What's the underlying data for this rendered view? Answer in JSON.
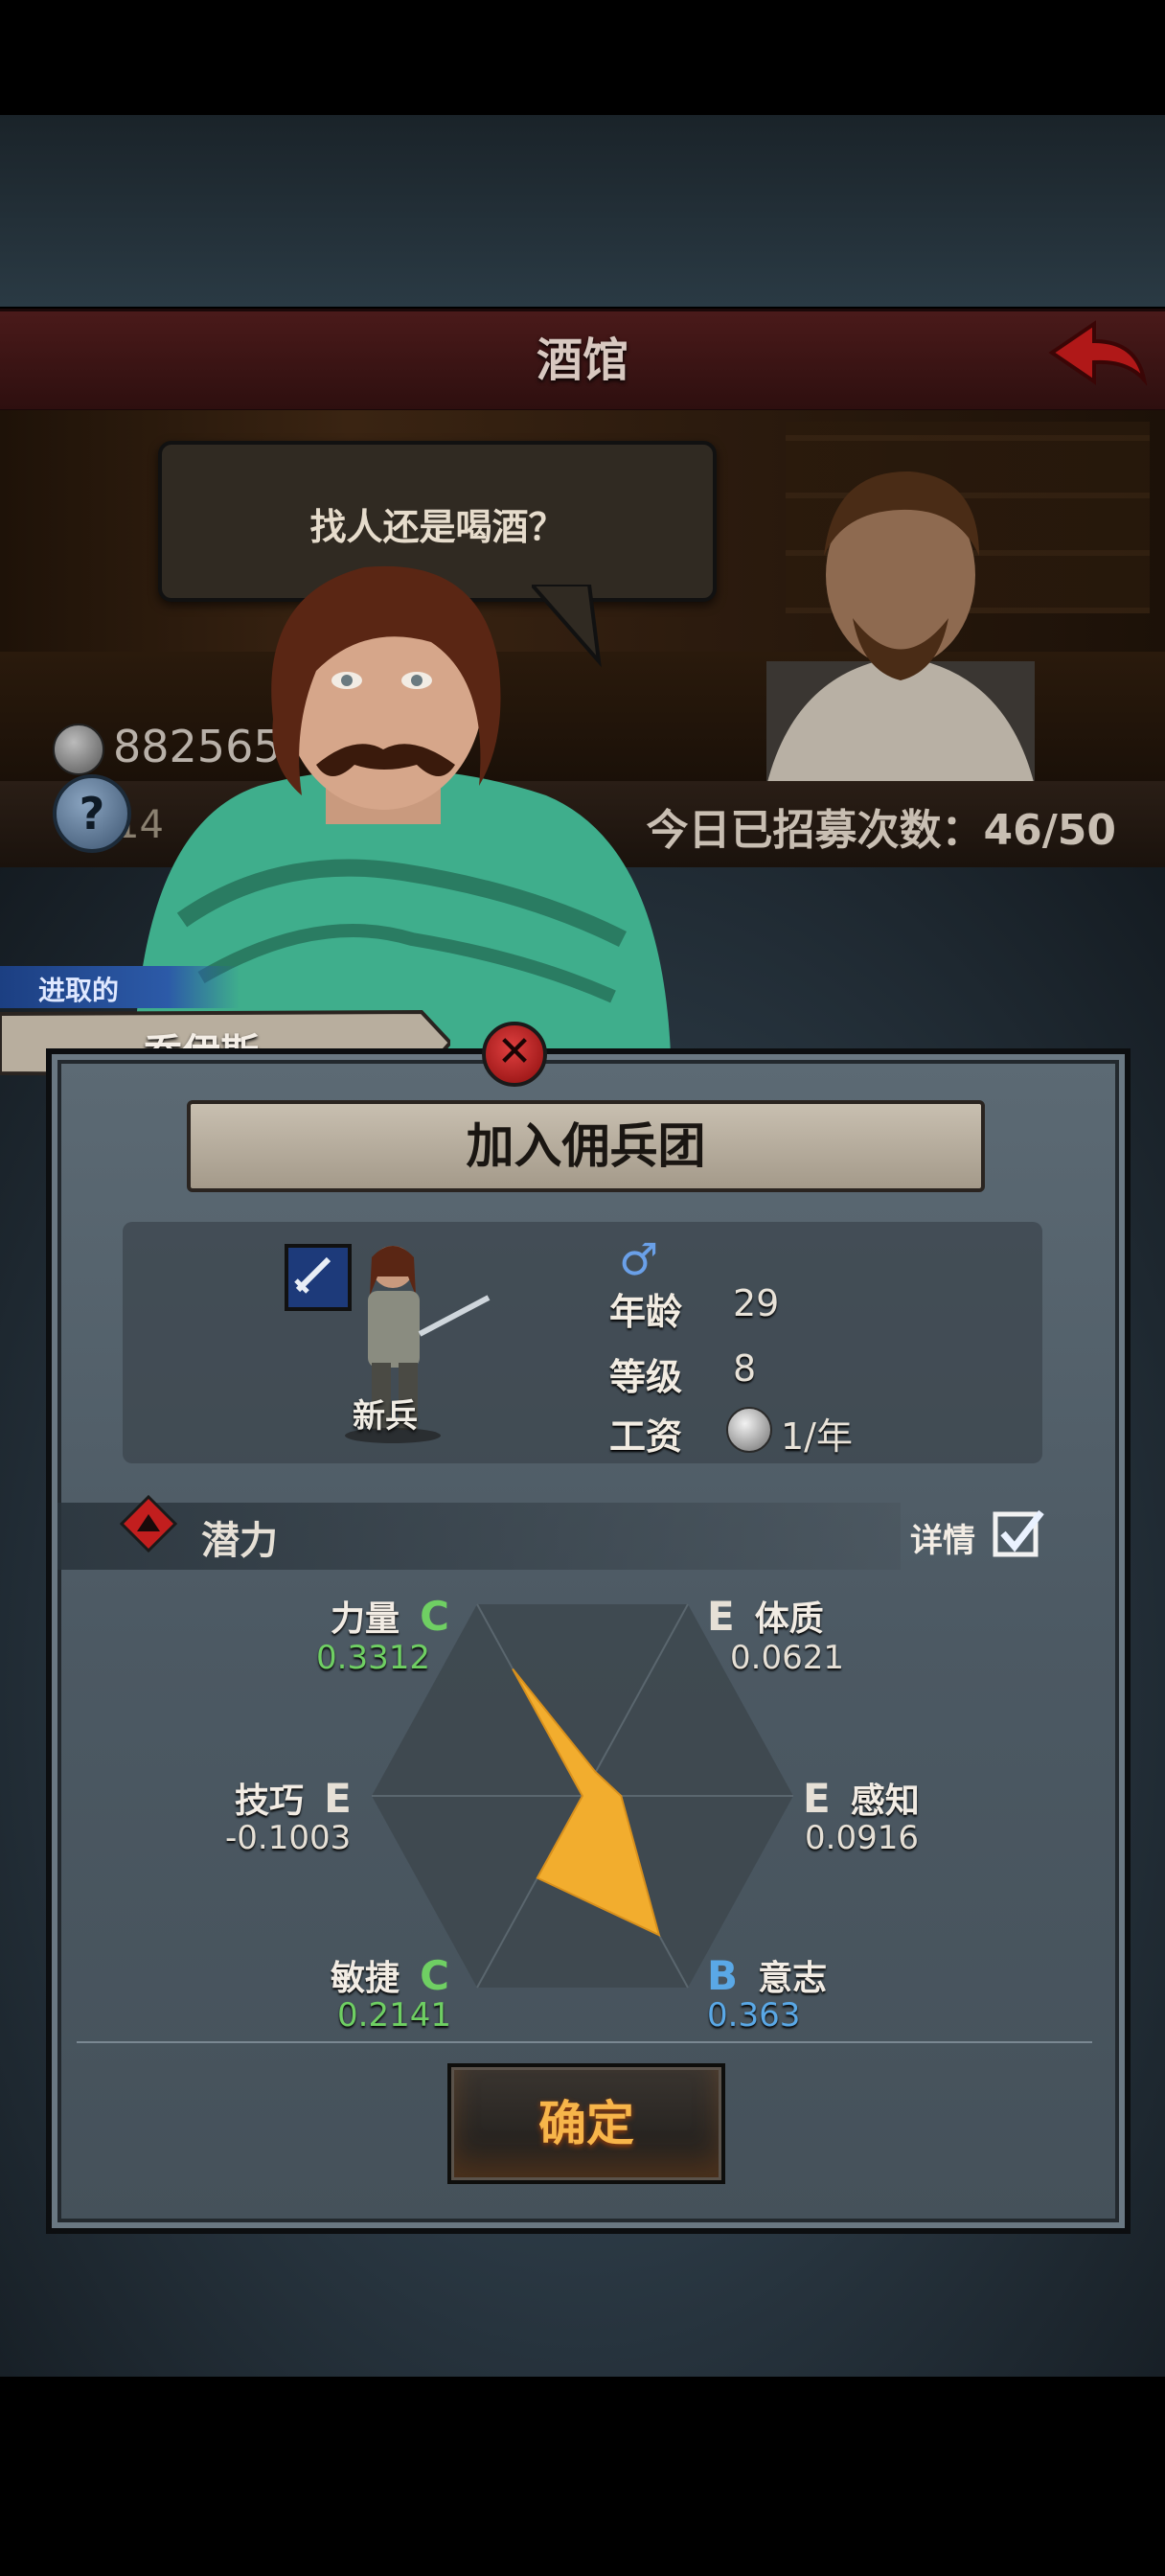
{
  "header": {
    "title": "酒馆",
    "back_icon": "back-arrow-icon"
  },
  "dialogue": {
    "text": "找人还是喝酒？"
  },
  "resources": {
    "silver": "882565",
    "gold": "14"
  },
  "recruit_status": {
    "text": "今日已招募次数：46/50"
  },
  "mercenary": {
    "trait": "进取的",
    "name": "乔伊斯",
    "class": "新兵",
    "gender_icon": "male-symbol-icon",
    "age_label": "年龄",
    "age": "29",
    "level_label": "等级",
    "level": "8",
    "wage_label": "工资",
    "wage": "1/年"
  },
  "panel": {
    "title": "加入佣兵团",
    "confirm_label": "确定"
  },
  "potential": {
    "label": "潜力",
    "details_label": "详情",
    "details_checked": true,
    "attributes": [
      {
        "name": "力量",
        "grade": "C",
        "value": "0.3312",
        "color": "#6fcf63"
      },
      {
        "name": "体质",
        "grade": "E",
        "value": "0.0621",
        "color": "#e6e0d6"
      },
      {
        "name": "感知",
        "grade": "E",
        "value": "0.0916",
        "color": "#e6e0d6"
      },
      {
        "name": "意志",
        "grade": "B",
        "value": "0.363",
        "color": "#5aa8e6"
      },
      {
        "name": "敏捷",
        "grade": "C",
        "value": "0.2141",
        "color": "#6fcf63"
      },
      {
        "name": "技巧",
        "grade": "E",
        "value": "-0.1003",
        "color": "#e6e0d6"
      }
    ],
    "radar_fill_color": "#f2ad2e"
  }
}
